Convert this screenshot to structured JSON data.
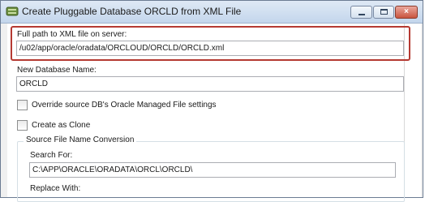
{
  "window": {
    "title": "Create Pluggable Database ORCLD from XML File",
    "icon": "database-icon",
    "controls": {
      "minimize": "minimize-icon",
      "maximize": "maximize-icon",
      "close": "×"
    }
  },
  "form": {
    "xml_path": {
      "label": "Full path to XML file on server:",
      "value": "/u02/app/oracle/oradata/ORCLOUD/ORCLD/ORCLD.xml"
    },
    "new_db_name": {
      "label": "New Database Name:",
      "value": "ORCLD"
    },
    "override_checkbox": {
      "label": "Override source DB's Oracle Managed File settings",
      "checked": false
    },
    "clone_checkbox": {
      "label": "Create as Clone",
      "checked": false
    },
    "conversion_group": {
      "title": "Source File Name Conversion",
      "search_for": {
        "label": "Search For:",
        "value": "C:\\APP\\ORACLE\\ORADATA\\ORCL\\ORCLD\\"
      },
      "replace_with": {
        "label": "Replace With:"
      }
    }
  },
  "colors": {
    "highlight_border": "#b53a32",
    "titlebar_top": "#dfe9f5",
    "titlebar_bottom": "#c4d6ec"
  }
}
